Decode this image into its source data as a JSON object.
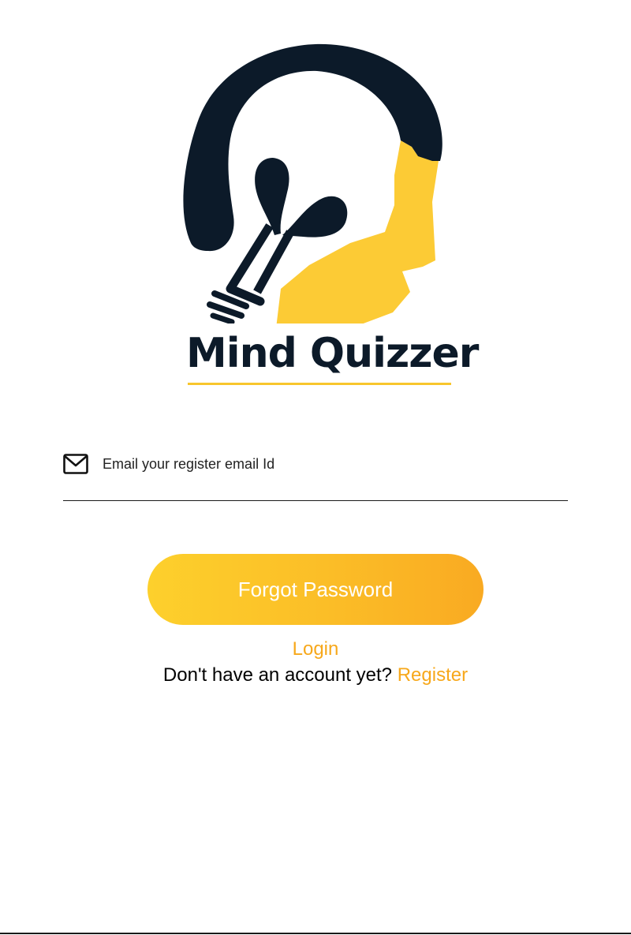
{
  "logo": {
    "text": "Mind Quizzer",
    "colors": {
      "dark": "#0c1a29",
      "yellow": "#fccb35"
    }
  },
  "email": {
    "icon": "envelope-icon",
    "placeholder": "Email your register email Id",
    "value": ""
  },
  "actions": {
    "forgot_label": "Forgot Password",
    "login_label": "Login",
    "register_prompt": "Don't have an account yet?",
    "register_label": "Register"
  },
  "colors": {
    "accent": "#f7a81b",
    "button_start": "#fdd02c",
    "button_end": "#f9aa22"
  }
}
